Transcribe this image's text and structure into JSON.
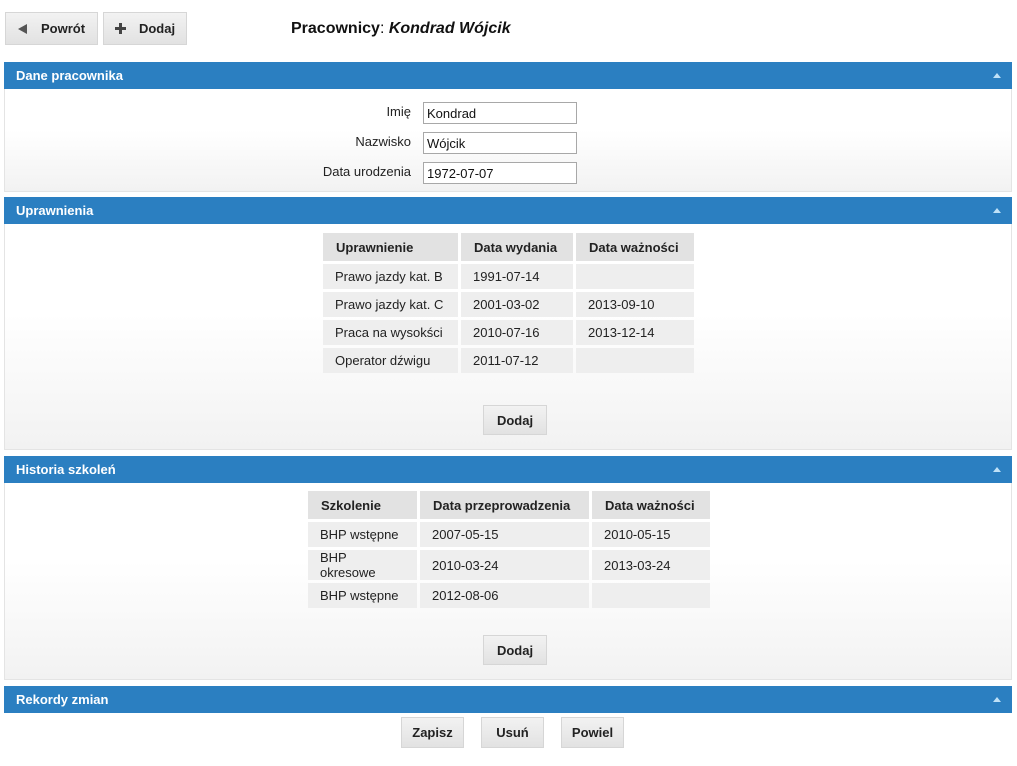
{
  "toolbar": {
    "back_label": "Powrót",
    "add_label": "Dodaj"
  },
  "title": {
    "prefix": "Pracownicy",
    "separator": ": ",
    "name": "Kondrad Wójcik"
  },
  "employee": {
    "header": "Dane pracownika",
    "first_name_label": "Imię",
    "first_name": "Kondrad",
    "last_name_label": "Nazwisko",
    "last_name": "Wójcik",
    "birth_label": "Data urodzenia",
    "birth": "1972-07-07"
  },
  "permissions": {
    "header": "Uprawnienia",
    "columns": [
      "Uprawnienie",
      "Data wydania",
      "Data ważności"
    ],
    "rows": [
      [
        "Prawo jazdy kat. B",
        "1991-07-14",
        ""
      ],
      [
        "Prawo jazdy kat. C",
        "2001-03-02",
        "2013-09-10"
      ],
      [
        "Praca na wysokści",
        "2010-07-16",
        "2013-12-14"
      ],
      [
        "Operator dźwigu",
        "2011-07-12",
        ""
      ]
    ],
    "add_label": "Dodaj"
  },
  "trainings": {
    "header": "Historia szkoleń",
    "columns": [
      "Szkolenie",
      "Data przeprowadzenia",
      "Data ważności"
    ],
    "rows": [
      [
        "BHP wstępne",
        "2007-05-15",
        "2010-05-15"
      ],
      [
        "BHP okresowe",
        "2010-03-24",
        "2013-03-24"
      ],
      [
        "BHP wstępne",
        "2012-08-06",
        ""
      ]
    ],
    "add_label": "Dodaj"
  },
  "changes": {
    "header": "Rekordy zmian"
  },
  "footer": {
    "save_label": "Zapisz",
    "delete_label": "Usuń",
    "duplicate_label": "Powiel"
  },
  "colors": {
    "section_header": "#2b7fc1"
  }
}
